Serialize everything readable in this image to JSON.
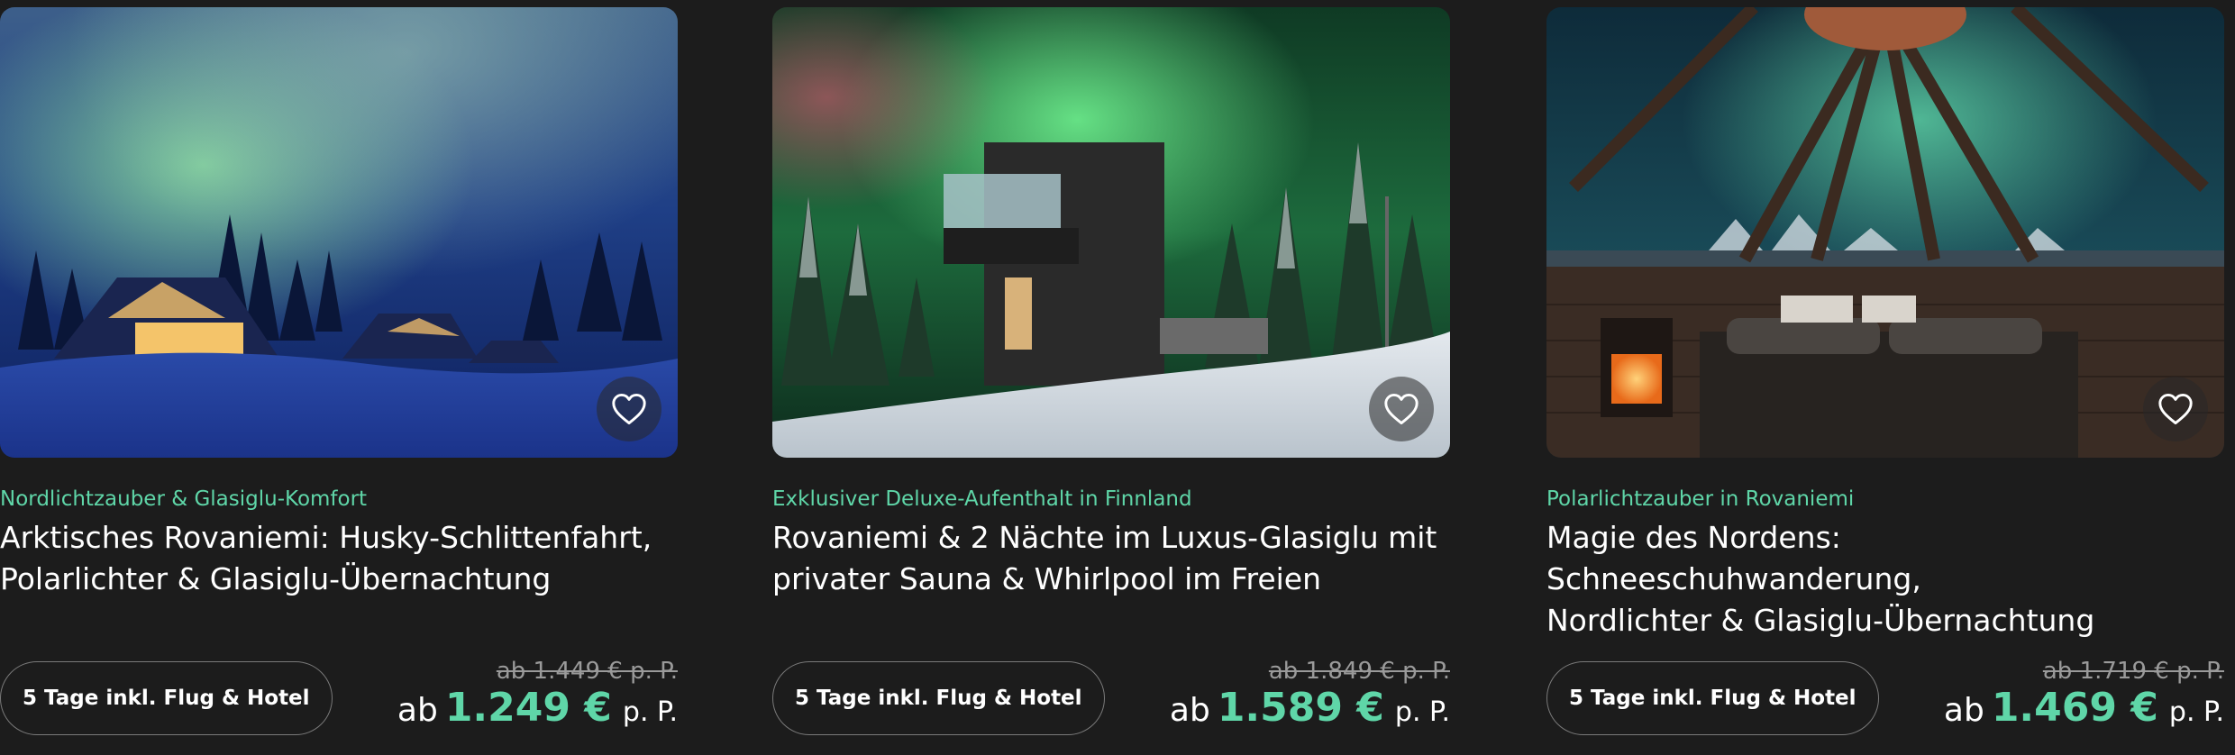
{
  "colors": {
    "background": "#1c1c1c",
    "accent": "#5fd6a8",
    "text": "#ffffff",
    "muted": "#9a9a9a"
  },
  "cards": [
    {
      "image_alt": "Glasiglus unter Nordlicht in verschneiter Landschaft",
      "favorite_icon": "heart-icon",
      "subtitle": "Nordlichtzauber & Glasiglu-Komfort",
      "title_line1": "Arktisches Rovaniemi: Husky-Schlittenfahrt,",
      "title_line2": "Polarlichter & Glasiglu-Übernachtung",
      "duration": "5 Tage inkl. Flug & Hotel",
      "old_price": "ab 1.449 € p. P.",
      "price_prefix": "ab",
      "price": "1.249 €",
      "price_suffix": "p. P."
    },
    {
      "image_alt": "Luxus-Glasiglu im Wald unter grünem Nordlicht",
      "favorite_icon": "heart-icon",
      "subtitle": "Exklusiver Deluxe-Aufenthalt in Finnland",
      "title_line1": "Rovaniemi & 2 Nächte im Luxus-Glasiglu mit",
      "title_line2": "privater Sauna & Whirlpool im Freien",
      "duration": "5 Tage inkl. Flug & Hotel",
      "old_price": "ab 1.849 € p. P.",
      "price_prefix": "ab",
      "price": "1.589 €",
      "price_suffix": "p. P."
    },
    {
      "image_alt": "Innenansicht eines Glasiglus mit Bett, Kamin und Nordlicht",
      "favorite_icon": "heart-icon",
      "subtitle": "Polarlichtzauber in Rovaniemi",
      "title_line1": "Magie des Nordens: Schneeschuhwanderung,",
      "title_line2": "Nordlichter & Glasiglu-Übernachtung",
      "duration": "5 Tage inkl. Flug & Hotel",
      "old_price": "ab 1.719 € p. P.",
      "price_prefix": "ab",
      "price": "1.469 €",
      "price_suffix": "p. P."
    }
  ]
}
